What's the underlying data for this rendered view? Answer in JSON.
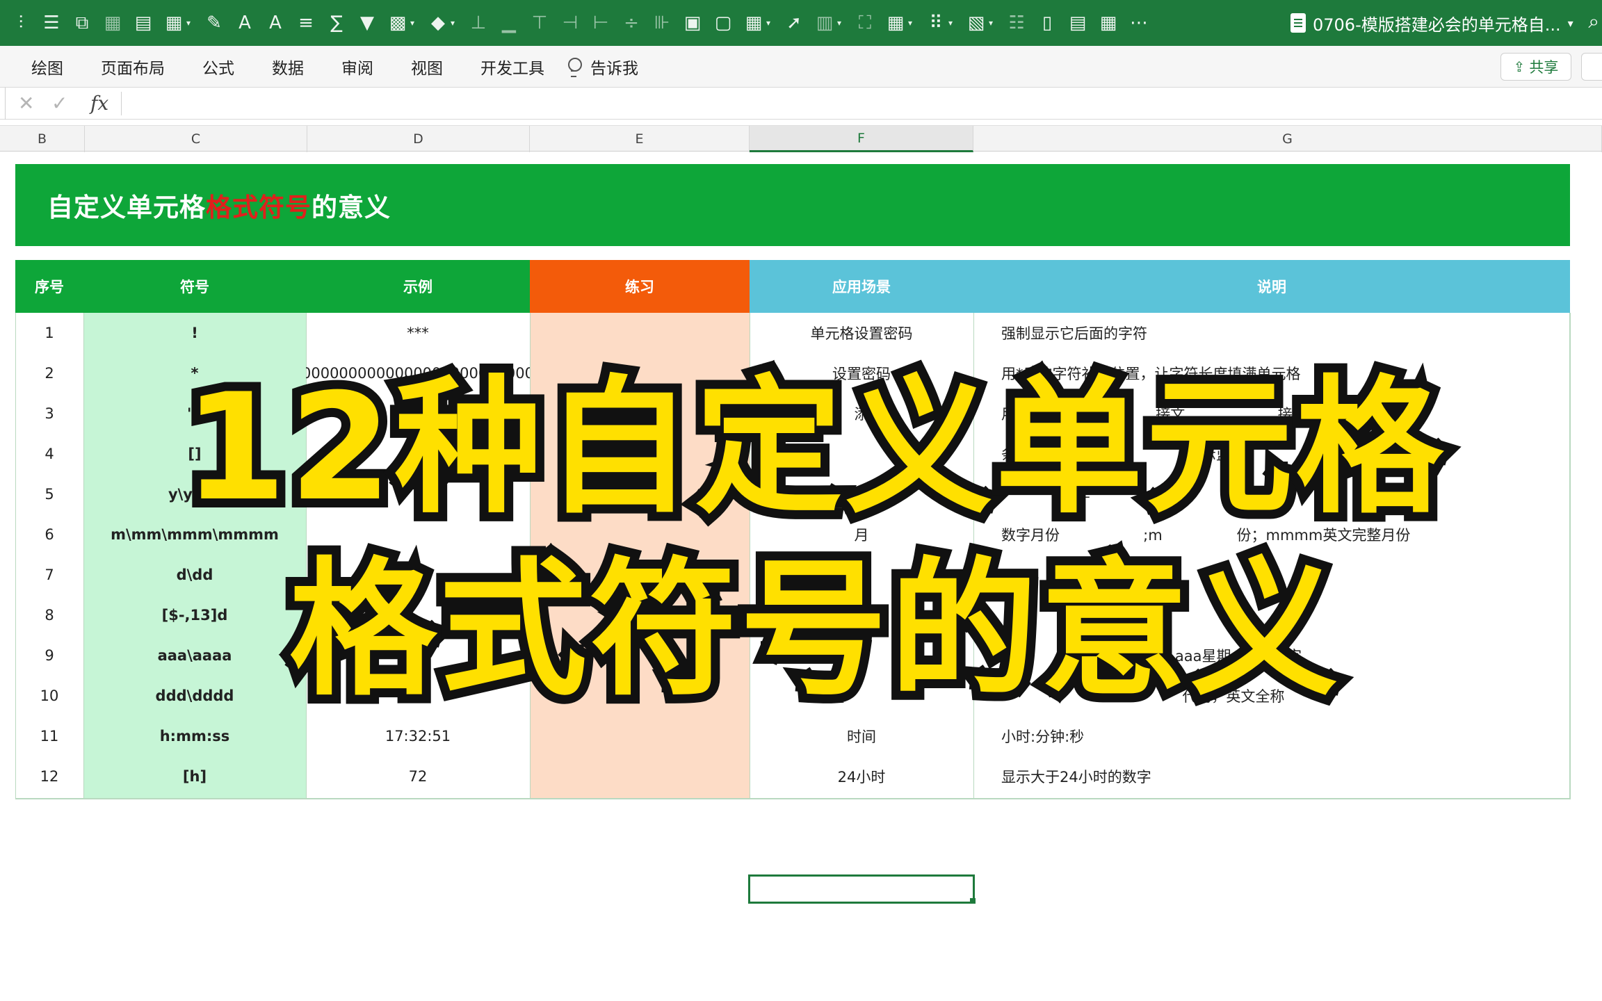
{
  "toolbar": {
    "doc_title": "0706-模版搭建必会的单元格自..."
  },
  "ribbon": {
    "tabs": [
      "绘图",
      "页面布局",
      "公式",
      "数据",
      "审阅",
      "视图",
      "开发工具"
    ],
    "tell_me": "告诉我",
    "share_label": "共享"
  },
  "formula_bar": {
    "fx_label": "fx",
    "value": ""
  },
  "columns": [
    "B",
    "C",
    "D",
    "E",
    "F",
    "G"
  ],
  "active_column": "F",
  "sheet": {
    "title_prefix": "自定义单元格",
    "title_highlight": "格式符号",
    "title_suffix": "的意义",
    "headers": [
      "序号",
      "符号",
      "示例",
      "练习",
      "应用场景",
      "说明"
    ],
    "rows": [
      {
        "no": "1",
        "symbol": "!",
        "example": "***",
        "practice": "",
        "scene": "单元格设置密码",
        "desc": "强制显示它后面的字符"
      },
      {
        "no": "2",
        "symbol": "*",
        "example": "000000000000000000000000000",
        "practice": "",
        "scene": "设置密码",
        "desc": "用*后的字符补齐位置，让字符长度填满单元格"
      },
      {
        "no": "3",
        "symbol": "\"\"",
        "example": "",
        "practice": "",
        "scene": "添",
        "desc": "用，                           接文                    接数字"
      },
      {
        "no": "4",
        "symbol": "[]",
        "example": "",
        "practice": "",
        "scene": "数               件标",
        "desc": "条                                        示蓝色"
      },
      {
        "no": "5",
        "symbol": "y\\yyyy",
        "example": "",
        "practice": "",
        "scene": "",
        "desc": "                年"
      },
      {
        "no": "6",
        "symbol": "m\\mm\\mmm\\mmmm",
        "example": "",
        "practice": "",
        "scene": "月",
        "desc": "数字月份                  ;m                份；mmmm英文完整月份"
      },
      {
        "no": "7",
        "symbol": "d\\dd",
        "example": "",
        "practice": "",
        "scene": "",
        "desc": "                    位日期"
      },
      {
        "no": "8",
        "symbol": "[$-,13]d",
        "example": "",
        "practice": "",
        "scene": "",
        "desc": ""
      },
      {
        "no": "9",
        "symbol": "aaa\\aaaa",
        "example": "",
        "practice": "",
        "scene": "",
        "desc": "                只显示            aaa星期+大写数字"
      },
      {
        "no": "10",
        "symbol": "ddd\\dddd",
        "example": "",
        "practice": "",
        "scene": "",
        "desc": "                                       代码，英文全称"
      },
      {
        "no": "11",
        "symbol": "h:mm:ss",
        "example": "17:32:51",
        "practice": "",
        "scene": "时间",
        "desc": "小时:分钟:秒"
      },
      {
        "no": "12",
        "symbol": "[h]",
        "example": "72",
        "practice": "",
        "scene": "24小时",
        "desc": "显示大于24小时的数字"
      }
    ]
  },
  "overlay": {
    "line1": "12种自定义单元格",
    "line2": "格式符号的意义"
  },
  "colors": {
    "app_green": "#1e7a3c",
    "banner_green": "#0ea639",
    "header_orange": "#f35b0a",
    "header_blue": "#5bc3d9",
    "symbol_col_bg": "#c6f5d6",
    "practice_col_bg": "#fddcc6",
    "title_red": "#e0201c",
    "overlay_yellow": "#ffe000"
  }
}
